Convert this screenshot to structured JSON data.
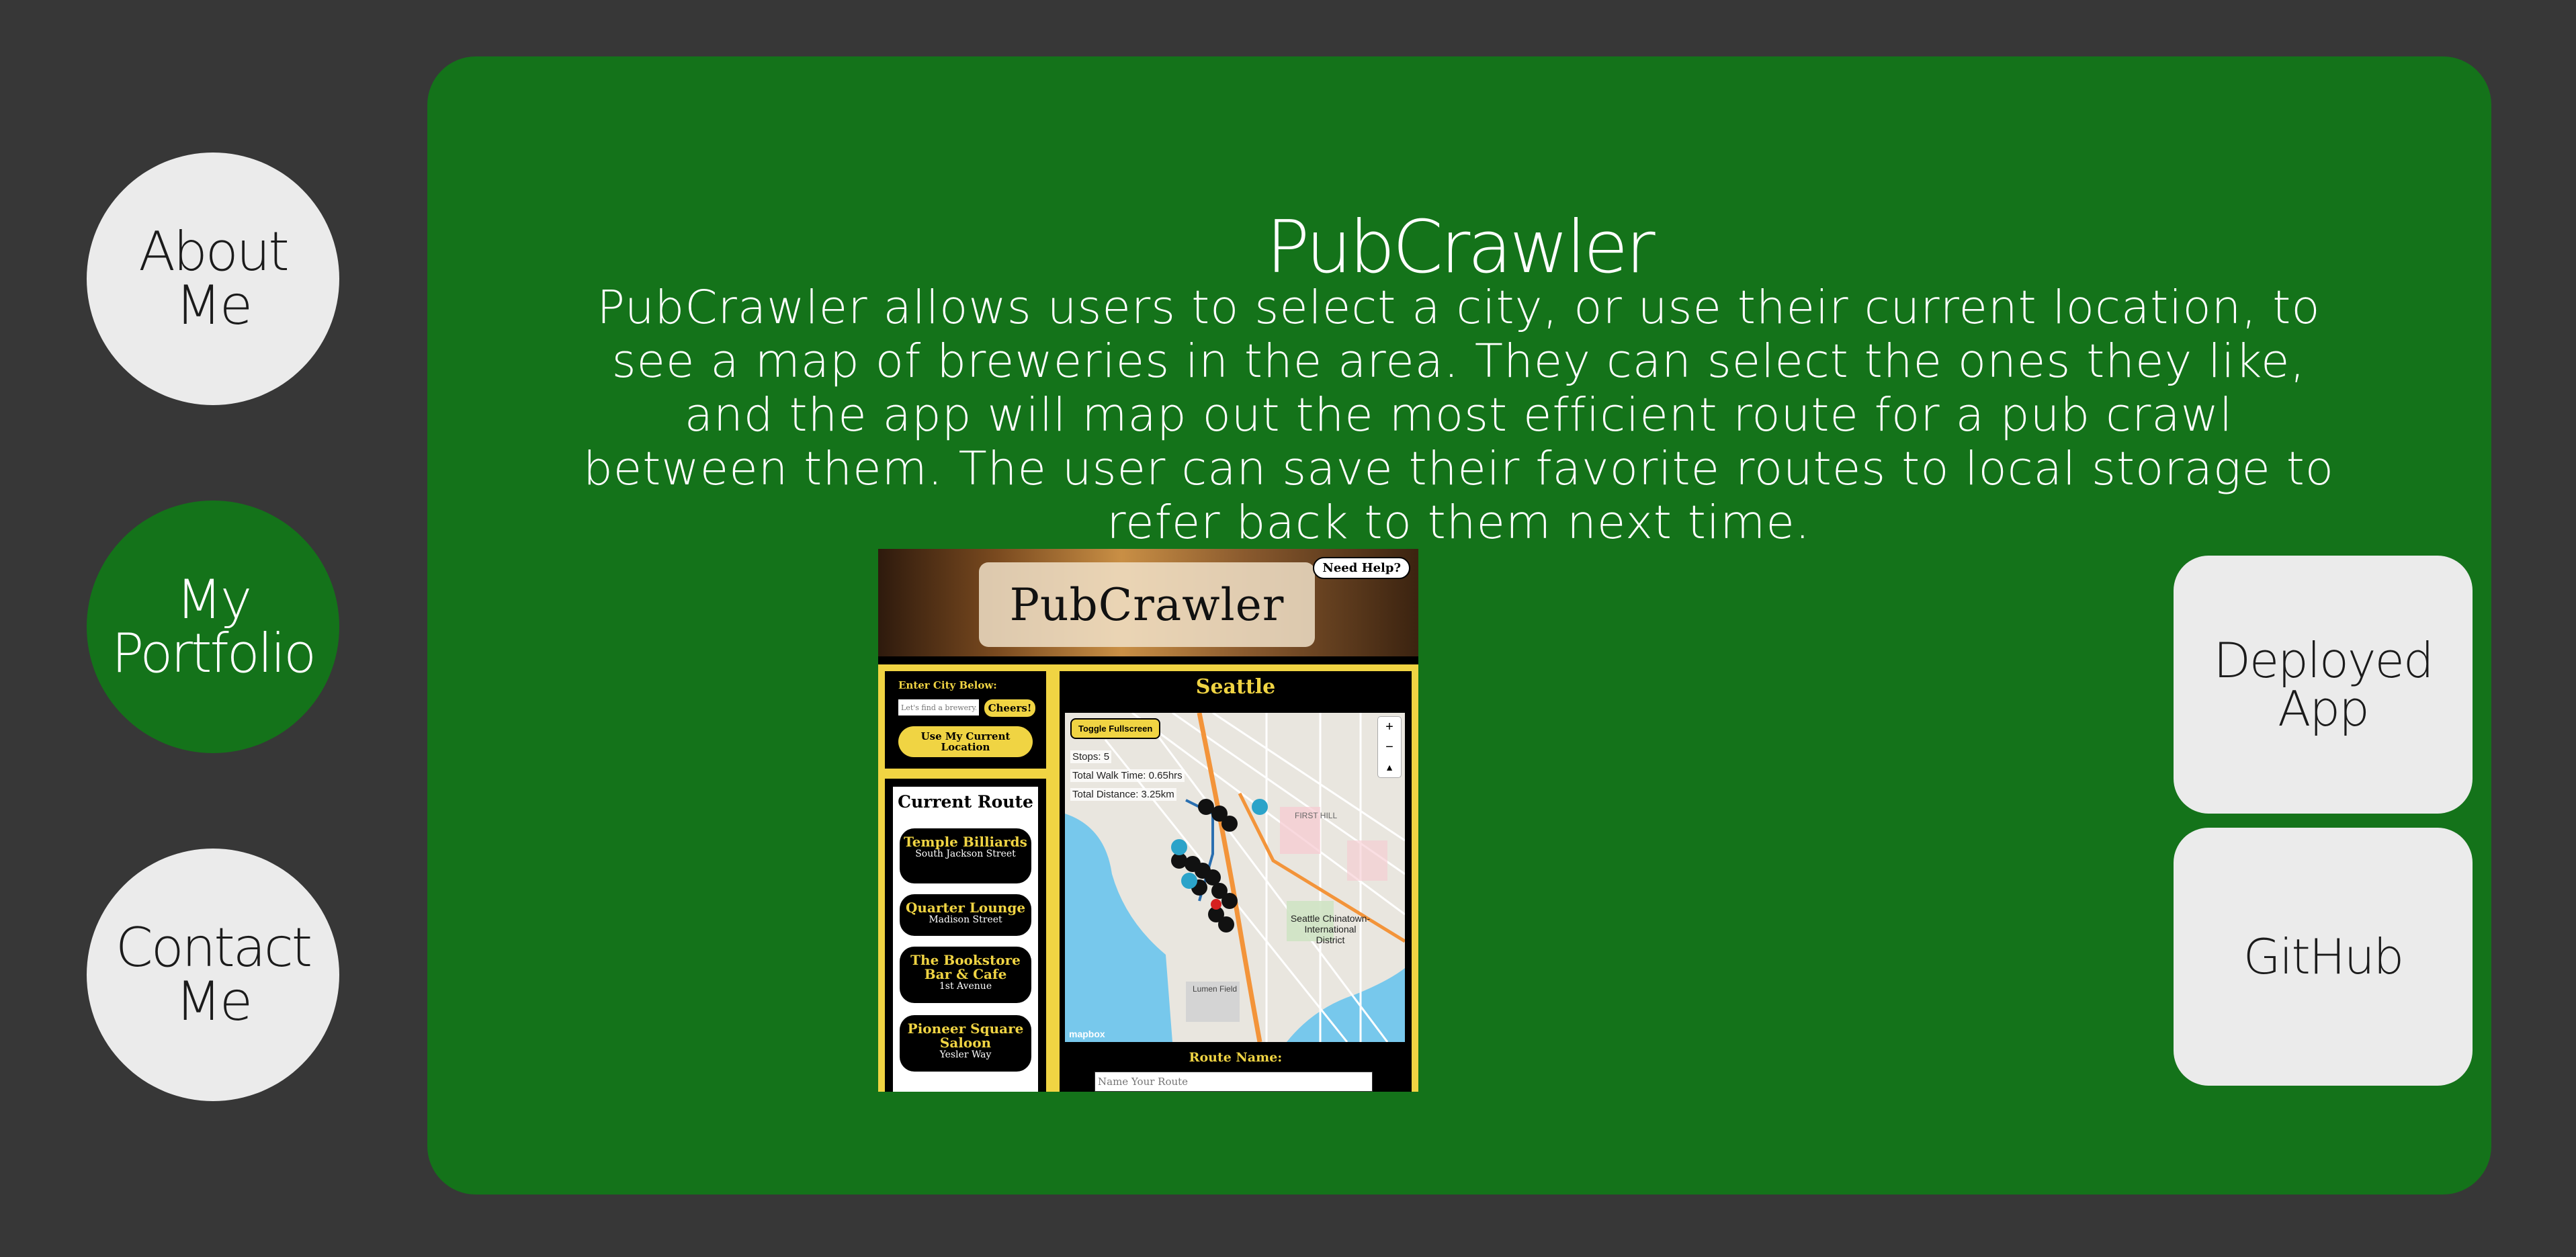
{
  "nav": {
    "about": "About Me",
    "portfolio": "My Portfolio",
    "contact": "Contact Me"
  },
  "project": {
    "title": "PubCrawler",
    "description": "PubCrawler allows users to select a city, or use their current location, to see a map of breweries in the area. They can select the ones they like, and the app will map out the most efficient route for a pub crawl between them. The user can save their favorite routes to local storage to refer back to them next time.",
    "deployed_label": "Deployed App",
    "github_label": "GitHub"
  },
  "screenshot": {
    "logo": "PubCrawler",
    "help_label": "Need Help?",
    "enter_city_label": "Enter City Below:",
    "city_placeholder": "Let's find a brewery...",
    "cheers_label": "Cheers!",
    "location_label": "Use My Current Location",
    "route_title": "Current Route",
    "stops": [
      {
        "name": "Temple Billiards",
        "street": "South Jackson Street"
      },
      {
        "name": "Quarter Lounge",
        "street": "Madison Street"
      },
      {
        "name": "The Bookstore Bar & Cafe",
        "street": "1st Avenue"
      },
      {
        "name": "Pioneer Square Saloon",
        "street": "Yesler Way"
      }
    ],
    "city": "Seattle",
    "fullscreen_label": "Toggle Fullscreen",
    "stops_stat": "Stops: 5",
    "walk_stat": "Total Walk Time: 0.65hrs",
    "distance_stat": "Total Distance: 3.25km",
    "map_label_chinatown": "Seattle Chinatown-International District",
    "map_label_first_hill": "FIRST HILL",
    "map_label_lumen": "Lumen Field",
    "map_attribution": "mapbox",
    "route_name_label": "Route Name:",
    "route_name_placeholder": "Name Your Route"
  },
  "colors": {
    "background": "#373737",
    "panel_green": "#14731a",
    "button_light": "#ebebeb",
    "screenshot_yellow": "#f0d443"
  }
}
